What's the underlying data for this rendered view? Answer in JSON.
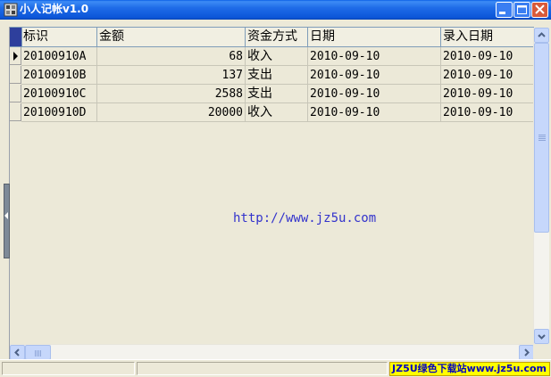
{
  "window": {
    "title": "小人记帐v1.0",
    "buttons": [
      "minimize",
      "maximize",
      "close"
    ]
  },
  "grid": {
    "columns": [
      "标识",
      "金额",
      "资金方式",
      "日期",
      "录入日期"
    ],
    "rows": [
      {
        "id": "20100910A",
        "amount": "68",
        "type": "收入",
        "date": "2010-09-10",
        "entry_date": "2010-09-10",
        "current": true
      },
      {
        "id": "20100910B",
        "amount": "137",
        "type": "支出",
        "date": "2010-09-10",
        "entry_date": "2010-09-10",
        "current": false
      },
      {
        "id": "20100910C",
        "amount": "2588",
        "type": "支出",
        "date": "2010-09-10",
        "entry_date": "2010-09-10",
        "current": false
      },
      {
        "id": "20100910D",
        "amount": "20000",
        "type": "收入",
        "date": "2010-09-10",
        "entry_date": "2010-09-10",
        "current": false
      }
    ]
  },
  "watermark": "http://www.jz5u.com",
  "status_bar": {
    "panels": [
      "",
      ""
    ],
    "brand": "JZ5U绿色下载站www.jz5u.com"
  },
  "colors": {
    "titlebar": "#0b55d8",
    "background": "#ece9d8",
    "grid_border": "#7f9db9",
    "watermark": "#3333cc",
    "brand_bg": "#ffff00",
    "brand_text": "#0000c0"
  }
}
